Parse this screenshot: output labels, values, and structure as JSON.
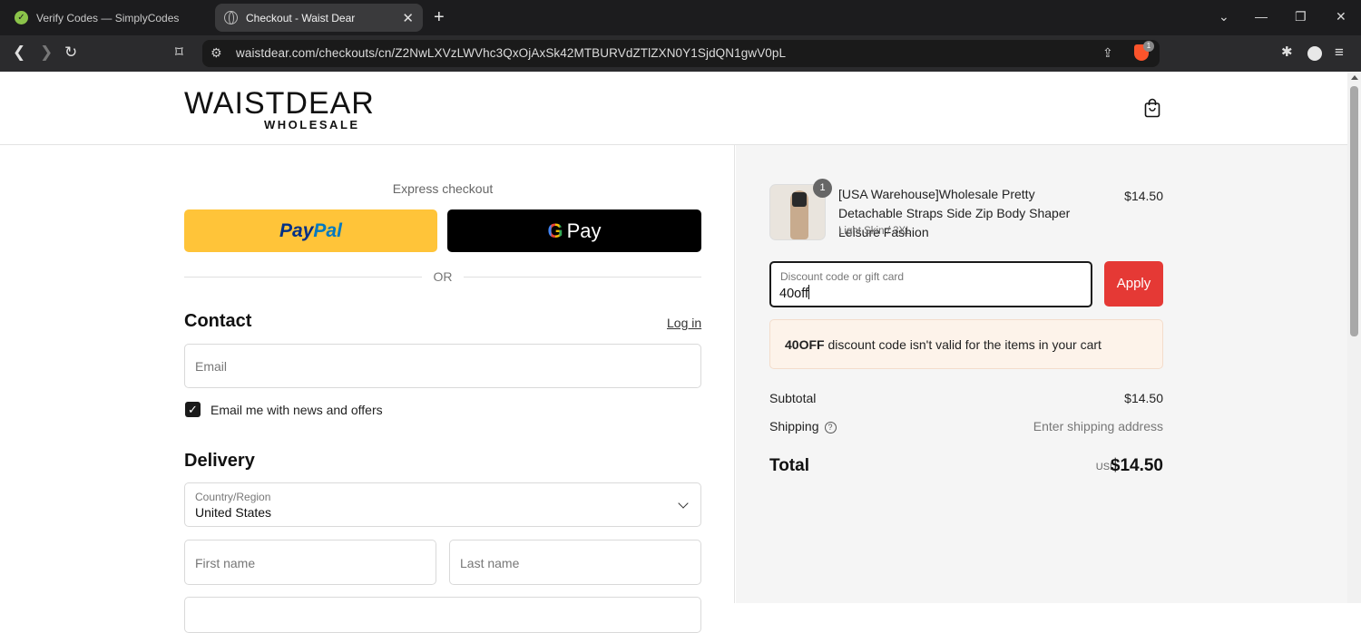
{
  "browser": {
    "tabs": [
      {
        "title": "Verify Codes — SimplyCodes",
        "active": false
      },
      {
        "title": "Checkout - Waist Dear",
        "active": true
      }
    ],
    "url": "waistdear.com/checkouts/cn/Z2NwLXVzLWVhc3QxOjAxSk42MTBURVdZTlZXN0Y1SjdQN1gwV0pL",
    "brave_badge": "1"
  },
  "header": {
    "logo_main": "WAISTDEAR",
    "logo_sub": "WHOLESALE"
  },
  "express": {
    "title": "Express checkout",
    "paypal_label_1": "Pay",
    "paypal_label_2": "Pal",
    "gpay_label": "Pay",
    "or": "OR"
  },
  "contact": {
    "heading": "Contact",
    "login": "Log in",
    "email_placeholder": "Email",
    "newsletter_label": "Email me with news and offers",
    "newsletter_checked": true
  },
  "delivery": {
    "heading": "Delivery",
    "country_label": "Country/Region",
    "country_value": "United States",
    "first_name_placeholder": "First name",
    "last_name_placeholder": "Last name"
  },
  "summary": {
    "item": {
      "quantity": "1",
      "title": "[USA Warehouse]Wholesale Pretty Detachable Straps Side Zip Body Shaper Leisure Fashion",
      "variant": "Light Skin / 3XL",
      "price": "$14.50"
    },
    "discount": {
      "label": "Discount code or gift card",
      "value": "40off",
      "apply": "Apply",
      "error_code": "40OFF",
      "error_text": " discount code isn't valid for the items in your cart"
    },
    "subtotal_label": "Subtotal",
    "subtotal_value": "$14.50",
    "shipping_label": "Shipping",
    "shipping_value": "Enter shipping address",
    "total_label": "Total",
    "total_currency": "USD",
    "total_value": "$14.50"
  },
  "colors": {
    "apply_button": "#e53935",
    "paypal": "#ffc439",
    "error_bg": "#fdf3ea"
  }
}
